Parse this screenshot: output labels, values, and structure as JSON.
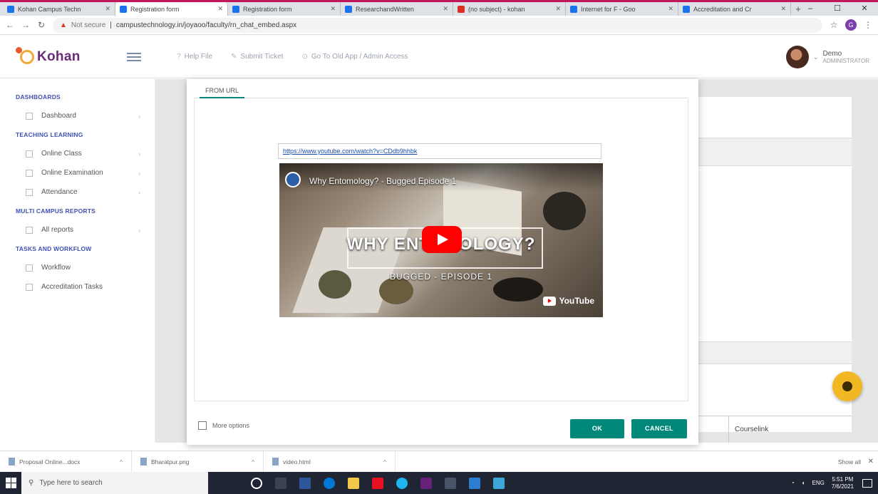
{
  "browser": {
    "tabs": [
      {
        "title": "Kohan Campus Techn",
        "active": false,
        "favicon": "blue"
      },
      {
        "title": "Registration form",
        "active": true,
        "favicon": "blue"
      },
      {
        "title": "Registration form",
        "active": false,
        "favicon": "blue"
      },
      {
        "title": "ResearchandWritten",
        "active": false,
        "favicon": "blue"
      },
      {
        "title": "(no subject) - kohan",
        "active": false,
        "favicon": "red"
      },
      {
        "title": "Internet for F - Goo",
        "active": false,
        "favicon": "blue"
      },
      {
        "title": "Accreditation and Cr",
        "active": false,
        "favicon": "blue"
      }
    ],
    "new_tab": "+",
    "window_controls": {
      "minimize": "–",
      "maximize": "☐",
      "close": "✕"
    },
    "nav": {
      "back": "←",
      "forward": "→",
      "reload": "↻"
    },
    "address": {
      "security": "Not secure",
      "url": "campustechnology.in/joyaoo/faculty/rn_chat_embed.aspx"
    },
    "star": "☆",
    "profile_initial": "G",
    "menu": "⋮"
  },
  "app": {
    "logo_text": "Kohan",
    "header_links": [
      {
        "icon": "?",
        "label": "Help File"
      },
      {
        "icon": "✎",
        "label": "Submit Ticket"
      },
      {
        "icon": "⊙",
        "label": "Go To Old App / Admin Access"
      }
    ],
    "user": {
      "name": "Demo",
      "role": "ADMINISTRATOR"
    }
  },
  "sidebar": {
    "sections": [
      {
        "title": "DASHBOARDS",
        "items": [
          "Dashboard"
        ]
      },
      {
        "title": "TEACHING LEARNING",
        "items": [
          "Online Class",
          "Online Examination",
          "Attendance"
        ]
      },
      {
        "title": "MULTI CAMPUS REPORTS",
        "items": [
          "All reports"
        ]
      },
      {
        "title": "TASKS AND WORKFLOW",
        "items": [
          "Workflow",
          "Accreditation Tasks"
        ]
      }
    ]
  },
  "background": {
    "column_header": "Courselink"
  },
  "modal": {
    "tab_label": "FROM URL",
    "url_value": "https://www.youtube.com/watch?v=CDdb9hhbk",
    "video": {
      "title": "Why Entomology? - Bugged Episode 1",
      "overlay_title": "WHY ENTOMOLOGY?",
      "overlay_sub": "BUGGED - EPISODE 1",
      "platform": "YouTube"
    },
    "more_options_label": "More options",
    "ok_label": "OK",
    "cancel_label": "CANCEL"
  },
  "downloads": {
    "items": [
      "Proposal Online...docx",
      "Bharatpur.png",
      "video.html"
    ],
    "show_all": "Show all"
  },
  "taskbar": {
    "search_placeholder": "Type here to search",
    "clock_time": "5:51 PM",
    "clock_date": "7/6/2021",
    "lang": "ENG"
  }
}
